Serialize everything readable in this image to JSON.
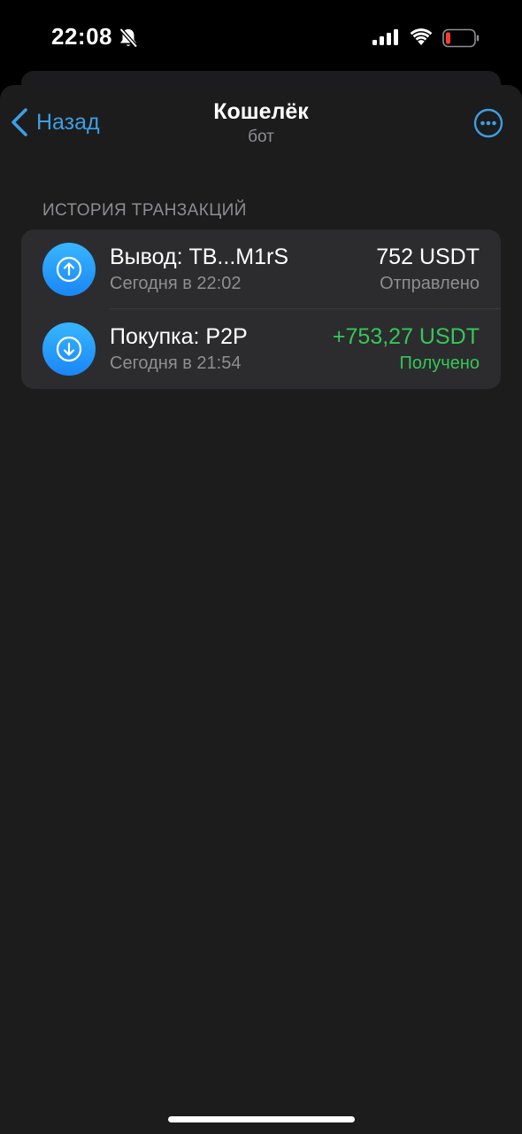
{
  "status_bar": {
    "time": "22:08"
  },
  "nav": {
    "back_label": "Назад",
    "title": "Кошелёк",
    "subtitle": "бот"
  },
  "section_header": "ИСТОРИЯ ТРАНЗАКЦИЙ",
  "transactions": [
    {
      "icon": "arrow-up-icon",
      "title": "Вывод: TB...M1rS",
      "time": "Сегодня в 22:02",
      "amount": "752 USDT",
      "status": "Отправлено",
      "amount_color": "#ffffff",
      "status_color": "#8e8e93"
    },
    {
      "icon": "arrow-down-icon",
      "title": "Покупка: P2P",
      "time": "Сегодня в 21:54",
      "amount": "+753,27 USDT",
      "status": "Получено",
      "amount_color": "#34c759",
      "status_color": "#34c759"
    }
  ],
  "colors": {
    "accent": "#3e9ee3",
    "background": "#1c1c1d",
    "card": "#2c2c2e",
    "received_green": "#34c759"
  }
}
